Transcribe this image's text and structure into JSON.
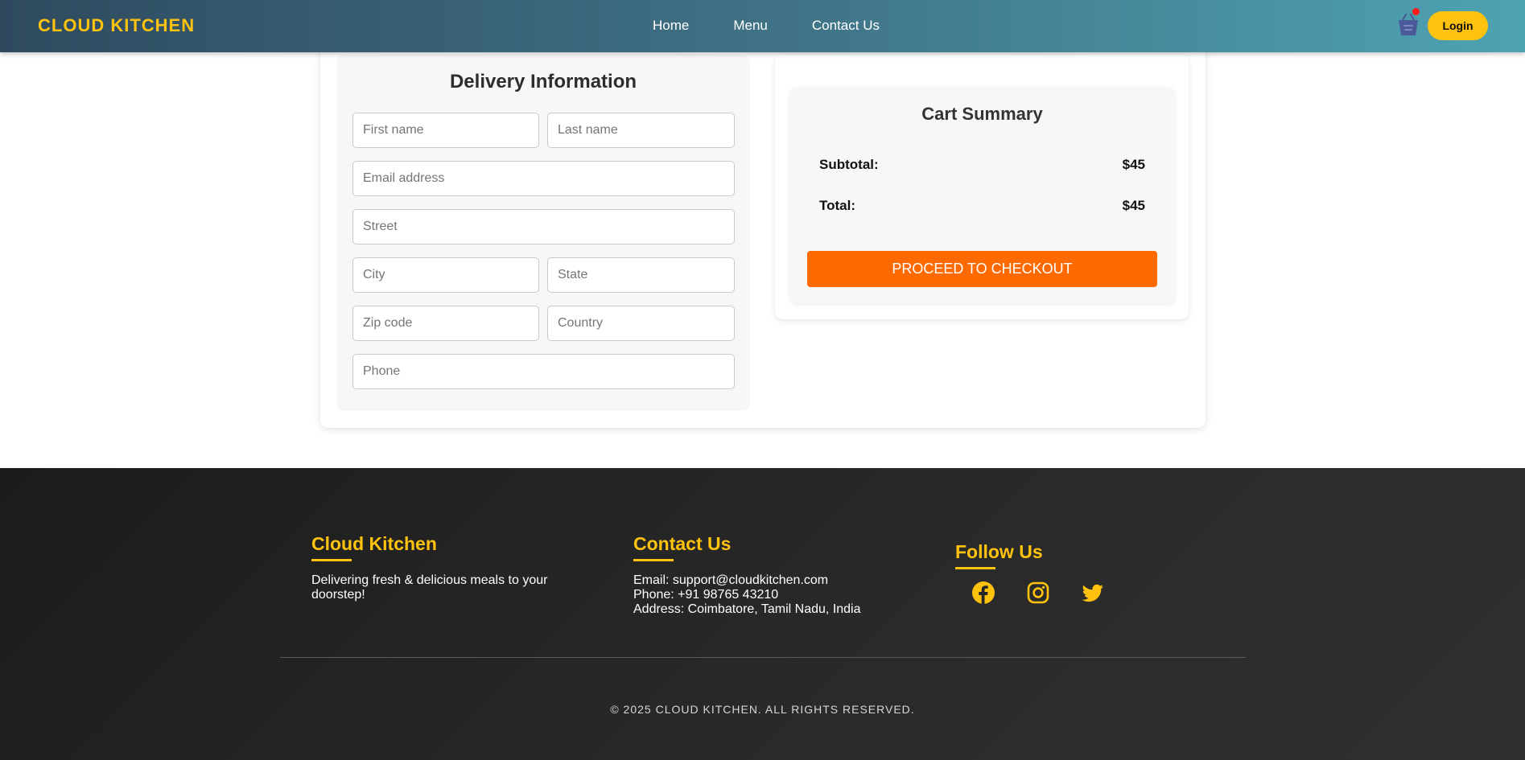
{
  "nav": {
    "brand": "CLOUD KITCHEN",
    "links": [
      "Home",
      "Menu",
      "Contact Us"
    ],
    "login": "Login",
    "cart_icon": "basket-icon",
    "cart_badge_color": "#ff1a1a"
  },
  "delivery": {
    "title": "Delivery Information",
    "placeholders": {
      "first_name": "First name",
      "last_name": "Last name",
      "email": "Email address",
      "street": "Street",
      "city": "City",
      "state": "State",
      "zip": "Zip code",
      "country": "Country",
      "phone": "Phone"
    }
  },
  "summary": {
    "title": "Cart Summary",
    "subtotal_label": "Subtotal:",
    "subtotal_value": "$45",
    "total_label": "Total:",
    "total_value": "$45",
    "checkout": "PROCEED TO CHECKOUT"
  },
  "footer": {
    "about": {
      "heading": "Cloud Kitchen",
      "line1": "Delivering fresh & delicious meals to your",
      "line2": "doorstep!"
    },
    "contact": {
      "heading": "Contact Us",
      "email": "Email: support@cloudkitchen.com",
      "phone": "Phone: +91 98765 43210",
      "address": "Address: Coimbatore, Tamil Nadu, India"
    },
    "follow": {
      "heading": "Follow Us",
      "icons": [
        "facebook-icon",
        "instagram-icon",
        "twitter-icon"
      ]
    },
    "copyright": "© 2025 CLOUD KITCHEN. ALL RIGHTS RESERVED."
  },
  "colors": {
    "accent": "#ffc20e",
    "checkout": "#ff6a00",
    "nav_start": "#2f4a5f",
    "nav_end": "#4ea3b3",
    "footer_bg": "#1c1c1c"
  }
}
